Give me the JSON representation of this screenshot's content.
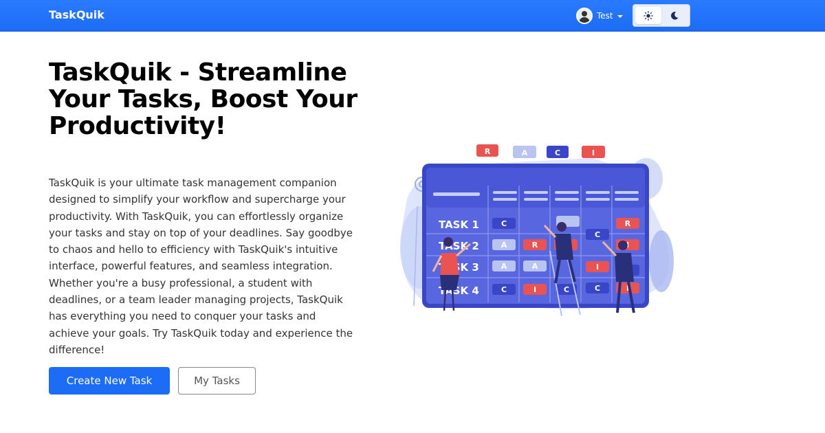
{
  "navbar": {
    "brand": "TaskQuik",
    "user": {
      "name": "Test",
      "avatar_icon": "user-avatar-icon",
      "caret_icon": "caret-down-icon"
    },
    "theme_toggle": {
      "light_icon": "sun-icon",
      "dark_icon": "moon-icon",
      "active": "light"
    }
  },
  "hero": {
    "title": "TaskQuik - Streamline Your Tasks, Boost Your Productivity!",
    "description": "TaskQuik is your ultimate task management companion designed to simplify your workflow and supercharge your productivity. With TaskQuik, you can effortlessly organize your tasks and stay on top of your deadlines. Say goodbye to chaos and hello to efficiency with TaskQuik's intuitive interface, powerful features, and seamless integration. Whether you're a busy professional, a student with deadlines, or a team leader managing projects, TaskQuik has everything you need to conquer your tasks and achieve your goals. Try TaskQuik today and experience the difference!",
    "primary_button": "Create New Task",
    "secondary_button": "My Tasks"
  },
  "illustration": {
    "header_tags": [
      "R",
      "A",
      "C",
      "I"
    ],
    "rows": [
      "TASK 1",
      "TASK 2",
      "TASK 3",
      "TASK 4"
    ]
  },
  "colors": {
    "primary": "#1d6cf5",
    "board": "#4a58d8",
    "tag_red": "#e95452",
    "tag_blue": "#3a46c8",
    "tag_light": "#b9c4f0"
  }
}
